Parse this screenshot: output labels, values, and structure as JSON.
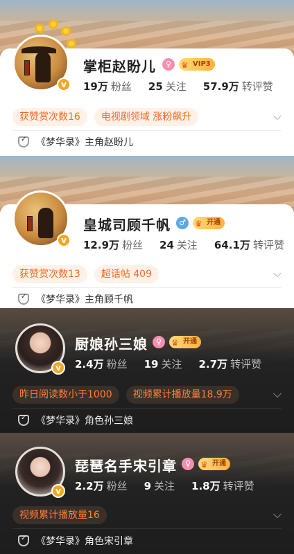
{
  "cards": [
    {
      "name": "掌柜赵盼儿",
      "gender_icon": "female-icon",
      "vip_label": "VIP3",
      "stats": [
        {
          "value": "19万",
          "label": "粉丝"
        },
        {
          "value": "25",
          "label": "关注"
        },
        {
          "value": "57.9万",
          "label": "转评赞"
        }
      ],
      "tags": [
        "获赞赏次数16",
        "电视剧领域 涨粉飙升"
      ],
      "role": "《梦华录》主角赵盼儿"
    },
    {
      "name": "皇城司顾千帆",
      "gender_icon": "male-icon",
      "vip_label": "开通",
      "stats": [
        {
          "value": "12.9万",
          "label": "粉丝"
        },
        {
          "value": "24",
          "label": "关注"
        },
        {
          "value": "64.1万",
          "label": "转评赞"
        }
      ],
      "tags": [
        "获赞赏次数13",
        "超话帖 409"
      ],
      "role": "《梦华录》主角顾千帆"
    },
    {
      "name": "厨娘孙三娘",
      "gender_icon": "female-icon",
      "vip_label": "开通",
      "stats": [
        {
          "value": "2.4万",
          "label": "粉丝"
        },
        {
          "value": "19",
          "label": "关注"
        },
        {
          "value": "2.7万",
          "label": "转评赞"
        }
      ],
      "tags": [
        "昨日阅读数小于1000",
        "视频累计播放量18.9万"
      ],
      "role": "《梦华录》角色孙三娘"
    },
    {
      "name": "琵琶名手宋引章",
      "gender_icon": "female-icon",
      "vip_label": "开通",
      "stats": [
        {
          "value": "2.2万",
          "label": "粉丝"
        },
        {
          "value": "9",
          "label": "关注"
        },
        {
          "value": "1.8万",
          "label": "转评赞"
        }
      ],
      "tags": [
        "视频累计播放量16"
      ],
      "role": "《梦华录》角色宋引章"
    }
  ],
  "colors": {
    "accent_orange": "#f26b22",
    "verified_gold": "#f5a623"
  }
}
